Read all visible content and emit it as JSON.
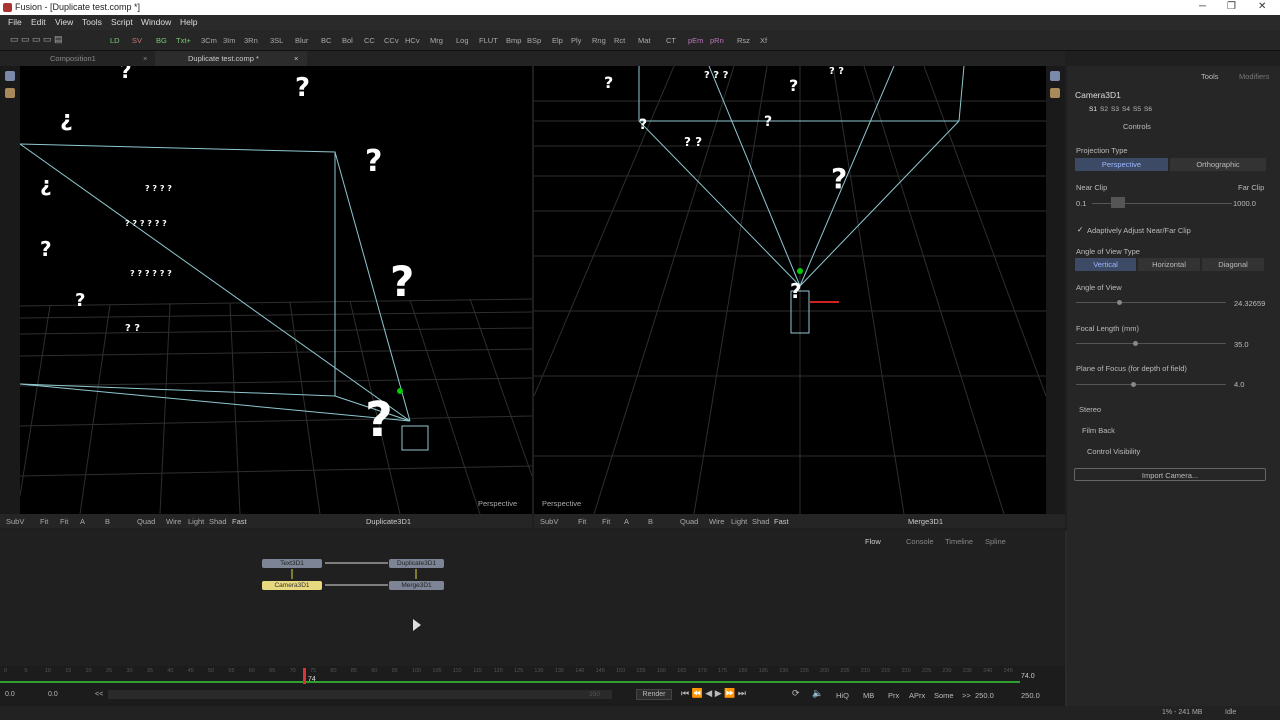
{
  "window": {
    "title": "Fusion - [Duplicate test.comp *]",
    "minimize": "─",
    "maximize": "❐",
    "close": "✕"
  },
  "menu": [
    "File",
    "Edit",
    "View",
    "Tools",
    "Script",
    "Window",
    "Help"
  ],
  "toolbar": [
    "LD",
    "SV",
    "BG",
    "Txt+",
    "3Cm",
    "3Im",
    "3Rn",
    "3SL",
    "Blur",
    "BC",
    "Bol",
    "CC",
    "CCv",
    "HCv",
    "Mrg",
    "Log",
    "FLUT",
    "Bmp",
    "BSp",
    "Elp",
    "Ply",
    "Rng",
    "Rct",
    "Mat",
    "CT",
    "pEm",
    "pRn",
    "Rsz",
    "Xf"
  ],
  "tabs": [
    {
      "label": "Composition1",
      "close": "×"
    },
    {
      "label": "Duplicate test.comp *",
      "close": "×"
    }
  ],
  "viewers": [
    {
      "label": "Perspective",
      "bar": [
        "SubV",
        "Fit",
        "Fit",
        "A",
        "B",
        "Quad",
        "Wire",
        "Light",
        "Shad",
        "Fast"
      ],
      "name": "Duplicate3D1"
    },
    {
      "label": "Perspective",
      "bar": [
        "SubV",
        "Fit",
        "Fit",
        "A",
        "B",
        "Quad",
        "Wire",
        "Light",
        "Shad",
        "Fast"
      ],
      "name": "Merge3D1"
    }
  ],
  "inspector": {
    "tabs": [
      "Tools",
      "Modifiers"
    ],
    "node": "Camera3D1",
    "versions": [
      "S1",
      "S2",
      "S3",
      "S4",
      "S5",
      "S6"
    ],
    "controls_tab": "Controls",
    "projection_type": {
      "label": "Projection Type",
      "options": [
        "Perspective",
        "Orthographic"
      ],
      "selected": "Perspective"
    },
    "near_clip": {
      "label": "Near Clip",
      "value": "0.1"
    },
    "far_clip": {
      "label": "Far Clip",
      "value": "1000.0"
    },
    "adaptive": {
      "label": "Adaptively Adjust Near/Far Clip",
      "checked": true,
      "mark": "✓"
    },
    "angle_type": {
      "label": "Angle of View Type",
      "options": [
        "Vertical",
        "Horizontal",
        "Diagonal"
      ],
      "selected": "Vertical"
    },
    "angle_of_view": {
      "label": "Angle of View",
      "value": "24.32659"
    },
    "focal_length": {
      "label": "Focal Length (mm)",
      "value": "35.0"
    },
    "plane_of_focus": {
      "label": "Plane of Focus (for depth of field)",
      "value": "4.0"
    },
    "sections": [
      "Stereo",
      "Film Back",
      "Control Visibility"
    ],
    "import_button": "Import Camera..."
  },
  "flow": {
    "tabs": [
      "Flow",
      "Console",
      "Timeline",
      "Spline"
    ],
    "nodes": [
      "Text3D1",
      "Duplicate3D1",
      "Camera3D1",
      "Merge3D1"
    ]
  },
  "timeline": {
    "current_frame": "74",
    "end_value": "74.0",
    "start_a": "0.0",
    "start_b": "0.0",
    "global_end": "250.0",
    "range_end": "250.0",
    "scroll_end": "250",
    "ticks": [
      "0",
      "5",
      "10",
      "15",
      "20",
      "25",
      "30",
      "35",
      "40",
      "45",
      "50",
      "55",
      "60",
      "65",
      "70",
      "75",
      "80",
      "85",
      "90",
      "95",
      "100",
      "105",
      "110",
      "115",
      "120",
      "125",
      "130",
      "135",
      "140",
      "145",
      "150",
      "155",
      "160",
      "165",
      "170",
      "175",
      "180",
      "185",
      "190",
      "195",
      "200",
      "205",
      "210",
      "215",
      "220",
      "225",
      "230",
      "235",
      "240",
      "245"
    ],
    "render": "Render",
    "buttons": [
      "HiQ",
      "MB",
      "Prx",
      "APrx",
      "Some"
    ],
    "arrows": "<<",
    "arrows2": ">>"
  },
  "status": {
    "memory": "1% - 241 MB",
    "state": "Idle"
  },
  "accent": "#3d4a66"
}
